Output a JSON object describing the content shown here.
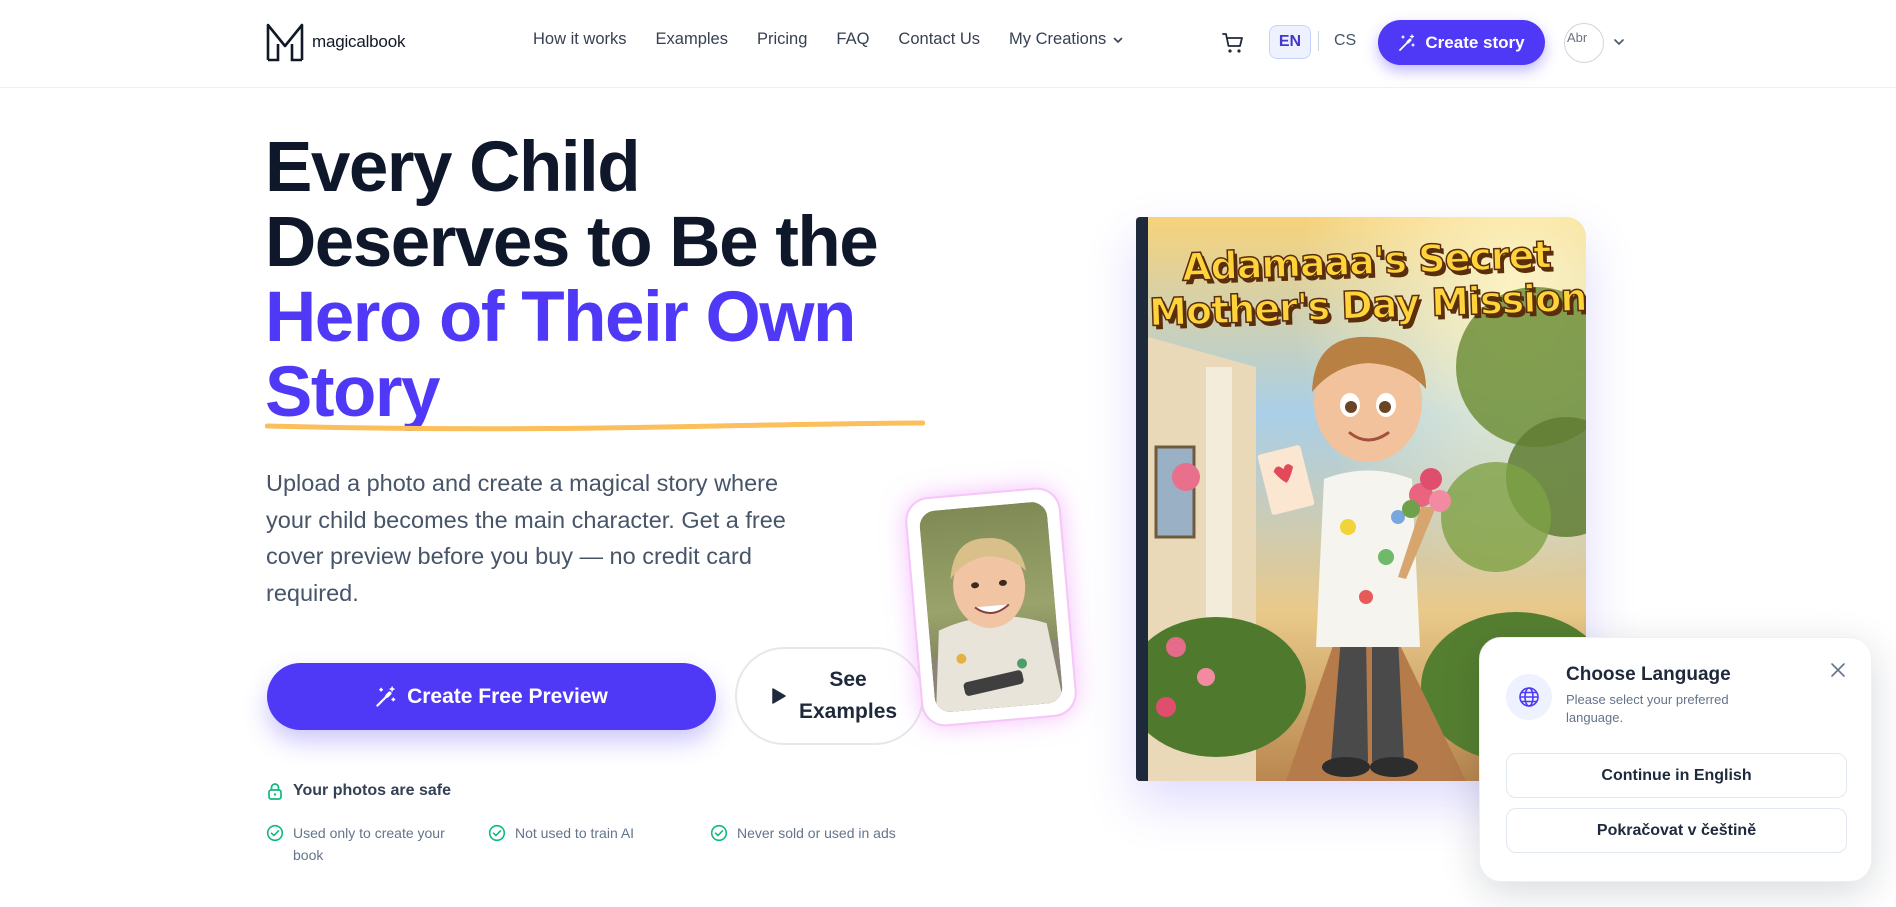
{
  "header": {
    "logo_text": "magicalbook",
    "nav": [
      {
        "label": "How it works"
      },
      {
        "label": "Examples"
      },
      {
        "label": "Pricing"
      },
      {
        "label": "FAQ"
      },
      {
        "label": "Contact Us"
      },
      {
        "label": "My Creations"
      }
    ],
    "lang_en": "EN",
    "lang_cs": "CS",
    "create_story_label": "Create story",
    "avatar_alt": "Abr"
  },
  "hero": {
    "headline_line1": "Every Child",
    "headline_line2": "Deserves to Be the",
    "headline_accent1": "Hero of Their Own",
    "headline_accent2": "Story",
    "subtext": "Upload a photo and create a magical story where your child becomes the main character. Get a free cover preview before you buy — no credit card required.",
    "cta_primary": "Create Free Preview",
    "cta_secondary_line1": "See",
    "cta_secondary_line2": "Examples",
    "safe_title": "Your photos are safe",
    "safe_items": [
      {
        "line1": "Used only to create your",
        "line2": "book"
      },
      {
        "line1": "Not used to train AI",
        "line2": ""
      },
      {
        "line1": "Never sold or used in ads",
        "line2": ""
      }
    ]
  },
  "book": {
    "title_line1": "Adamaaa's Secret",
    "title_line2": "Mother's Day Mission"
  },
  "language_modal": {
    "title": "Choose Language",
    "subtitle": "Please select your preferred language.",
    "english_button": "Continue in English",
    "czech_button": "Pokračovat v češtině"
  },
  "colors": {
    "accent": "#4f39f6",
    "underline": "#fbbf5b",
    "safe_green": "#10b981"
  }
}
